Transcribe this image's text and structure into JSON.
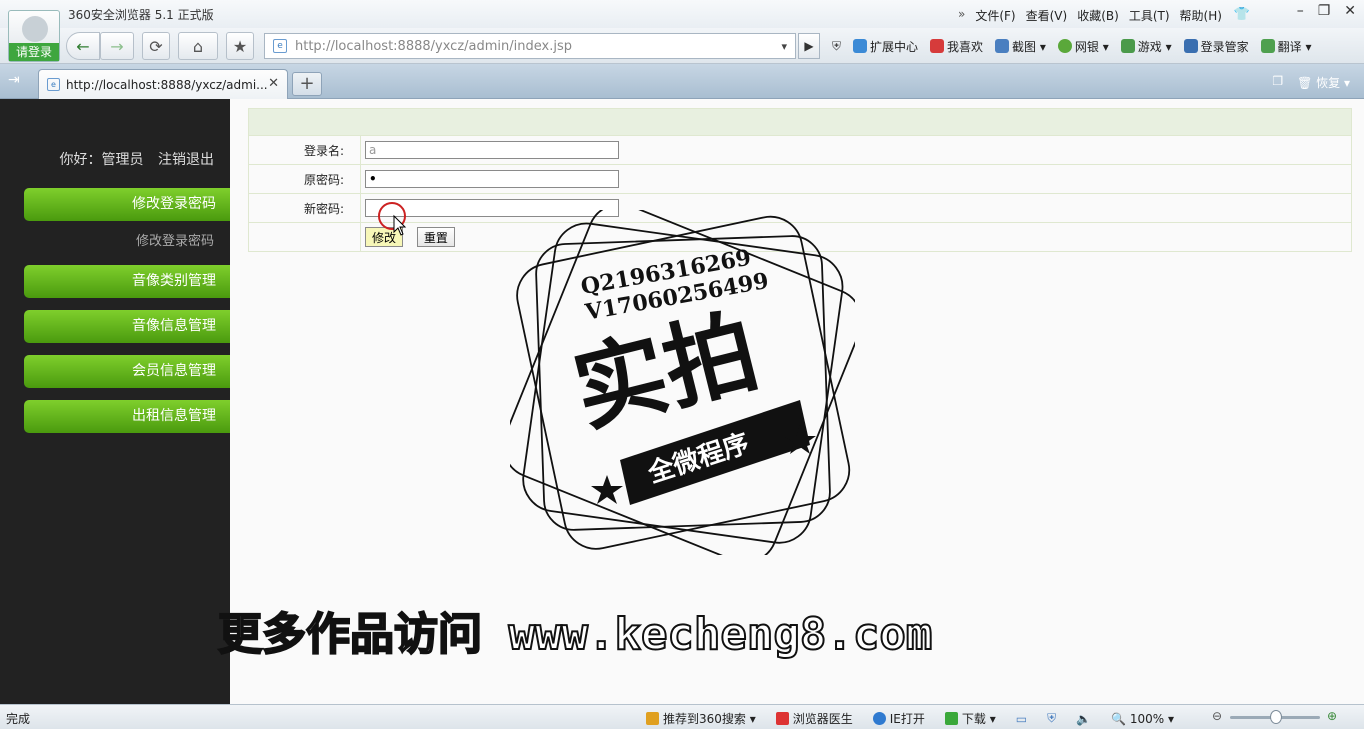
{
  "window": {
    "title": "360安全浏览器 5.1 正式版",
    "login_label": "请登录",
    "menu": [
      "文件(F)",
      "查看(V)",
      "收藏(B)",
      "工具(T)",
      "帮助(H)"
    ],
    "menu_chevron": "»",
    "minimize": "–",
    "restore": "❐",
    "close": "✕"
  },
  "nav": {
    "back": "←",
    "forward": "→",
    "refresh": "⟳",
    "home": "⌂",
    "favorite": "★",
    "url": "http://localhost:8888/yxcz/admin/index.jsp",
    "url_dropdown": "▾",
    "go": "▶",
    "toolbar": [
      "扩展中心",
      "我喜欢",
      "截图",
      "网银",
      "游戏",
      "登录管家",
      "翻译"
    ]
  },
  "tabs": {
    "side_toggle": "⇥",
    "active_tab_title": "http://localhost:8888/yxcz/admi...",
    "close": "✕",
    "new_tab": "+",
    "restore_label": "恢复"
  },
  "sidebar": {
    "greeting": "你好：管理员",
    "logout": "注销退出",
    "items": [
      {
        "label": "修改登录密码"
      },
      {
        "label": "音像类别管理"
      },
      {
        "label": "音像信息管理"
      },
      {
        "label": "会员信息管理"
      },
      {
        "label": "出租信息管理"
      }
    ],
    "sub_item": "修改登录密码"
  },
  "form": {
    "rows": [
      {
        "label": "登录名:",
        "value": "a"
      },
      {
        "label": "原密码:",
        "value": "•"
      },
      {
        "label": "新密码:",
        "value": ""
      }
    ],
    "submit_label": "修改",
    "reset_label": "重置"
  },
  "overlay": {
    "stamp_line1": "Q2196316269",
    "stamp_line2": "V17060256499",
    "stamp_main": "实拍",
    "stamp_banner": "全微程序",
    "watermark": "更多作品访问 www.kecheng8.com"
  },
  "status": {
    "left": "完成",
    "items": [
      "推荐到360搜索",
      "浏览器医生",
      "IE打开",
      "下载"
    ],
    "zoom": "100%"
  },
  "colors": {
    "sidebar_bg": "#222222",
    "sidebar_button": "#5fb51a",
    "accent_green": "#3ea63e"
  }
}
